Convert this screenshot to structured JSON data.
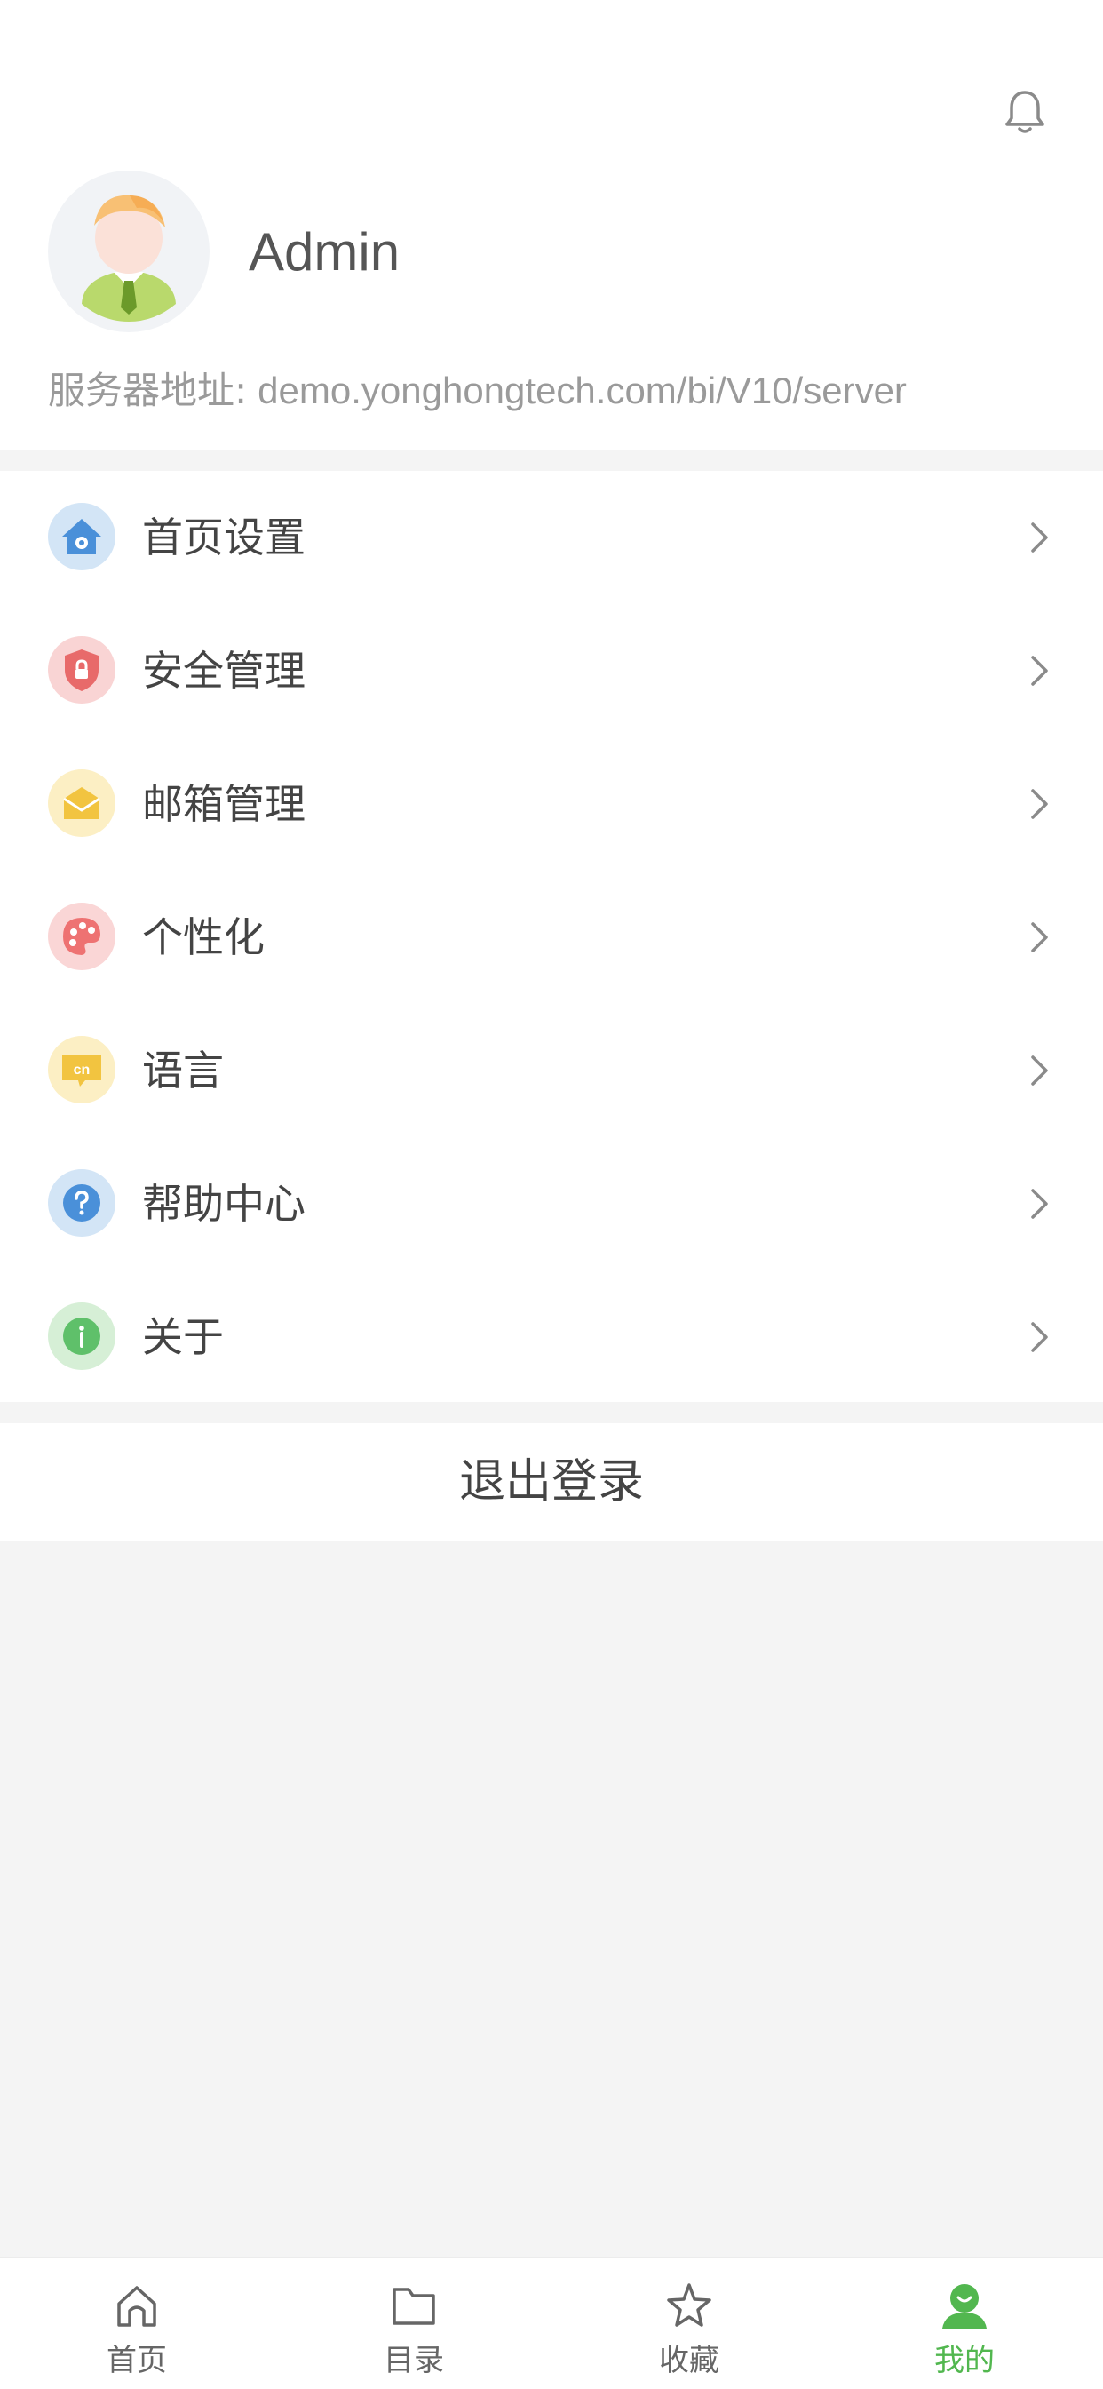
{
  "header": {
    "bell_icon": "bell-icon"
  },
  "profile": {
    "username": "Admin",
    "server_label": "服务器地址:",
    "server_value": "demo.yonghongtech.com/bi/V10/server"
  },
  "menu": [
    {
      "label": "首页设置",
      "icon": "home-settings-icon",
      "color": "#4a90d9"
    },
    {
      "label": "安全管理",
      "icon": "security-shield-icon",
      "color": "#e86a6a"
    },
    {
      "label": "邮箱管理",
      "icon": "mail-icon",
      "color": "#f2c440"
    },
    {
      "label": "个性化",
      "icon": "palette-icon",
      "color": "#ee7272"
    },
    {
      "label": "语言",
      "icon": "language-cn-icon",
      "color": "#f2c440"
    },
    {
      "label": "帮助中心",
      "icon": "help-icon",
      "color": "#4a90d9"
    },
    {
      "label": "关于",
      "icon": "info-icon",
      "color": "#5fc06a"
    }
  ],
  "logout_label": "退出登录",
  "tabs": [
    {
      "label": "首页",
      "icon": "home-icon",
      "active": false
    },
    {
      "label": "目录",
      "icon": "folder-icon",
      "active": false
    },
    {
      "label": "收藏",
      "icon": "star-icon",
      "active": false
    },
    {
      "label": "我的",
      "icon": "user-icon",
      "active": true
    }
  ],
  "colors": {
    "accent": "#52b74f",
    "page_background": "#f4f4f4",
    "text_secondary": "#9a9a9a"
  }
}
